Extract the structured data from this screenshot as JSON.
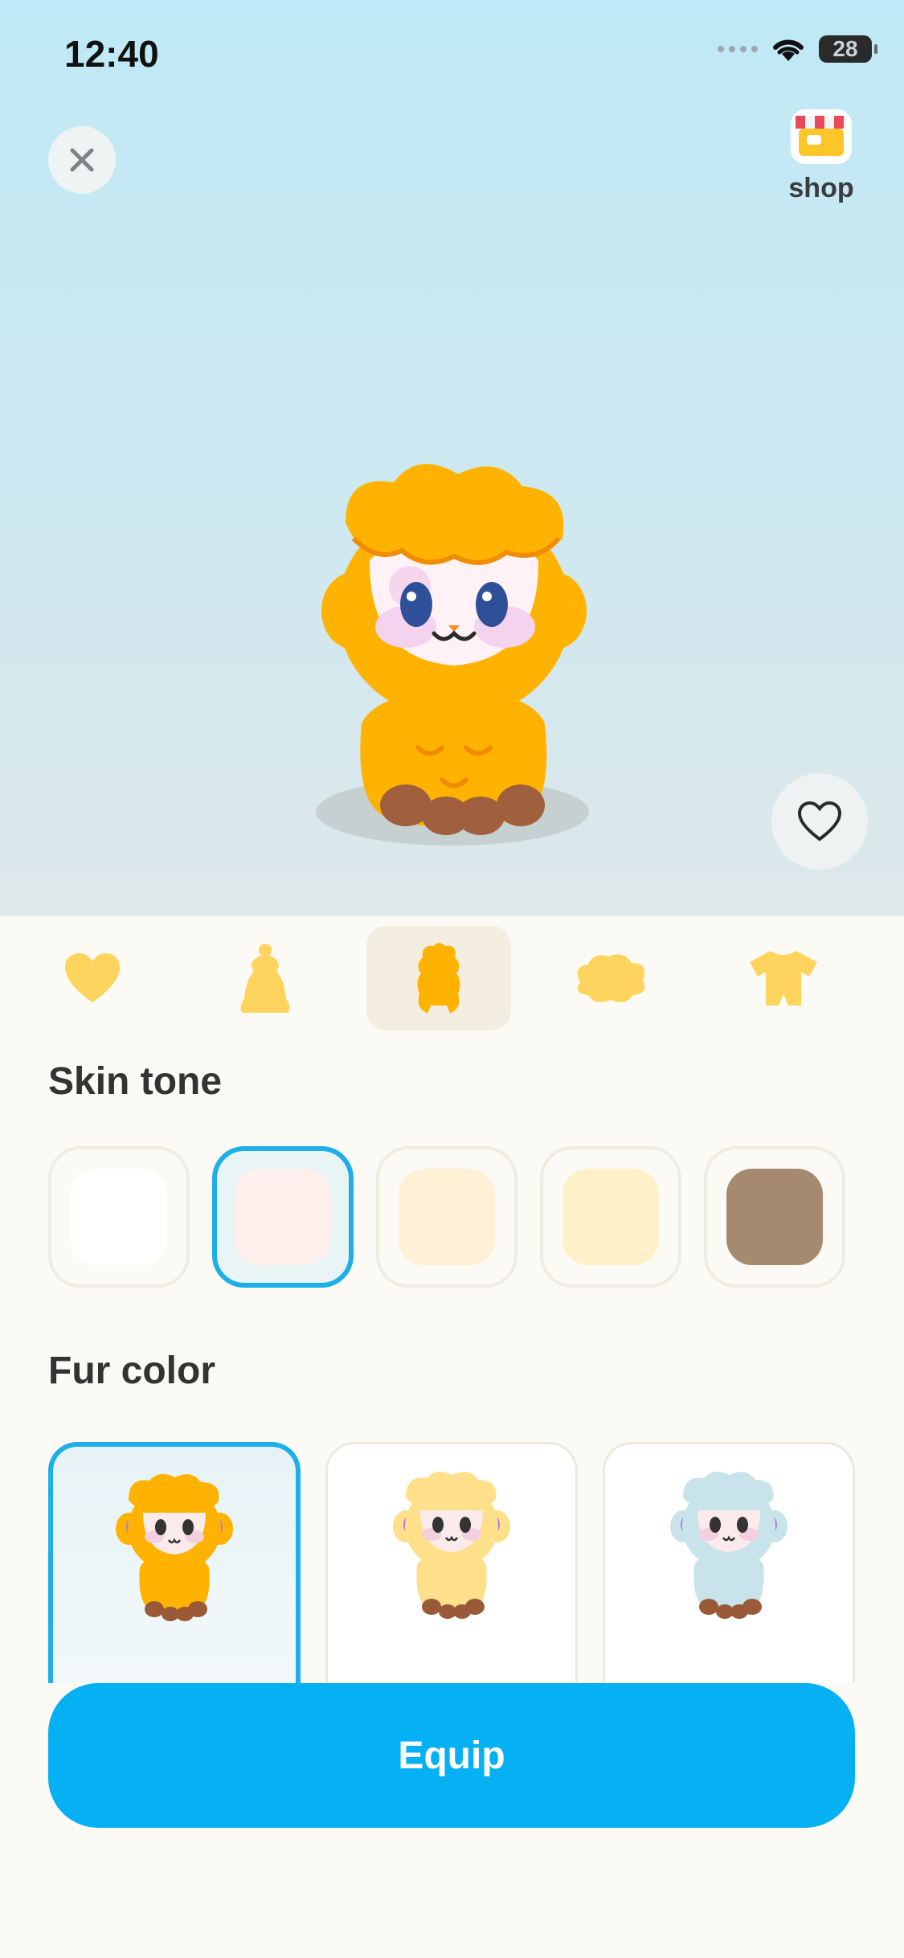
{
  "status_bar": {
    "time": "12:40",
    "battery": "28"
  },
  "header": {
    "close_icon": "close-icon",
    "shop_label": "shop",
    "shop_icon": "shop-icon"
  },
  "tabs": [
    {
      "icon": "heart-icon"
    },
    {
      "icon": "body-shape-icon"
    },
    {
      "icon": "sheep-silhouette-icon",
      "active": true
    },
    {
      "icon": "hair-icon"
    },
    {
      "icon": "outfit-icon"
    }
  ],
  "skin_tone": {
    "title": "Skin tone",
    "colors": [
      "#ffffff",
      "#fff0ee",
      "#fff0d6",
      "#fff0c8",
      "#a68a70"
    ],
    "selected_index": 1
  },
  "fur_color": {
    "title": "Fur color",
    "colors": [
      "#ffb300",
      "#ffe08a",
      "#c8e4ea"
    ],
    "selected_index": 0
  },
  "equip_label": "Equip",
  "colors": {
    "accent": "#06b1f3",
    "selection": "#1cafe8",
    "tab_icon": "#ffd45e"
  }
}
